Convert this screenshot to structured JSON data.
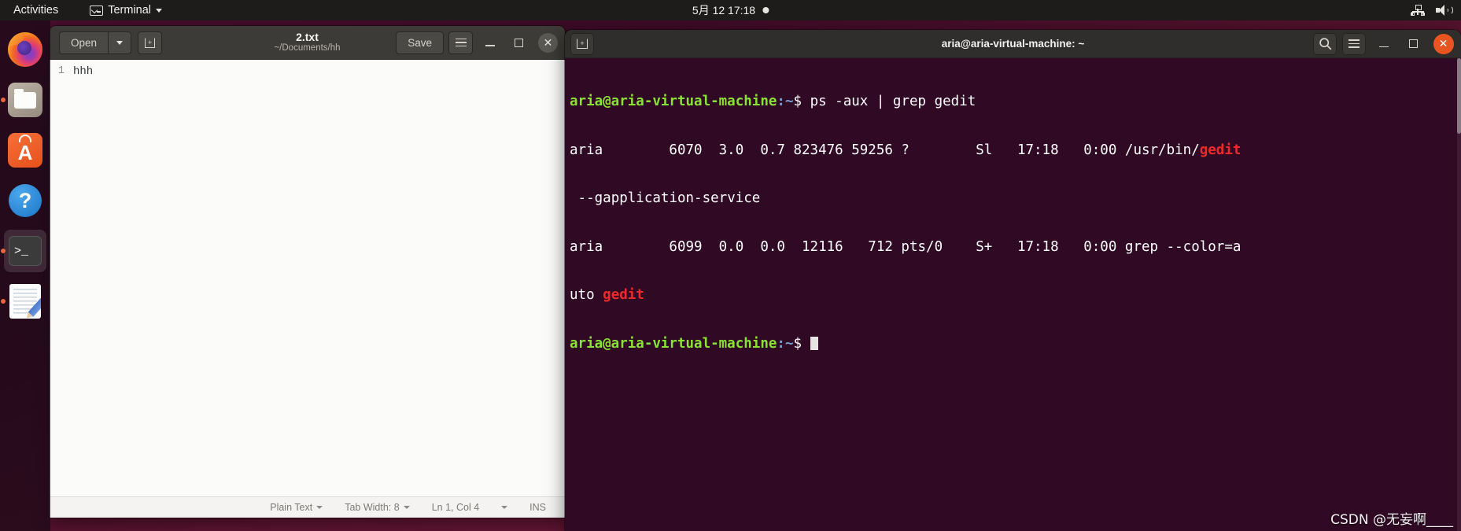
{
  "topbar": {
    "activities": "Activities",
    "app_name": "Terminal",
    "app_icon": "terminal-icon",
    "clock": "5月 12  17:18",
    "notification_dot": "●",
    "network_icon": "network-wired-icon",
    "volume_icon": "volume-icon"
  },
  "dock": {
    "items": [
      {
        "name": "firefox",
        "label": "Firefox Web Browser",
        "running": false,
        "active": false
      },
      {
        "name": "files",
        "label": "Files",
        "running": true,
        "active": false
      },
      {
        "name": "ubuntu-software",
        "label": "Ubuntu Software",
        "running": false,
        "active": false
      },
      {
        "name": "help",
        "label": "Help",
        "running": false,
        "active": false
      },
      {
        "name": "terminal",
        "label": "Terminal",
        "running": true,
        "active": true
      },
      {
        "name": "text-editor",
        "label": "Text Editor",
        "running": true,
        "active": false
      }
    ]
  },
  "gedit": {
    "open_label": "Open",
    "new_tab_icon": "new-document-icon",
    "title": "2.txt",
    "subtitle": "~/Documents/hh",
    "save_label": "Save",
    "menu_icon": "hamburger-menu-icon",
    "minimize_icon": "minimize-icon",
    "maximize_icon": "maximize-icon",
    "close_icon": "close-icon",
    "document": {
      "lines": [
        {
          "number": "1",
          "text": "hhh"
        }
      ]
    },
    "statusbar": {
      "language": "Plain Text",
      "tab_width": "Tab Width: 8",
      "position": "Ln 1, Col 4",
      "insert_mode": "INS"
    }
  },
  "terminal": {
    "new_tab_icon": "new-tab-icon",
    "title": "aria@aria-virtual-machine: ~",
    "search_icon": "search-icon",
    "menu_icon": "hamburger-menu-icon",
    "minimize_icon": "minimize-icon",
    "maximize_icon": "maximize-icon",
    "close_icon": "close-icon",
    "prompt_user": "aria@aria-virtual-machine",
    "prompt_path": ":~",
    "prompt_symbol": "$ ",
    "lines": [
      {
        "type": "command",
        "user": "aria@aria-virtual-machine",
        "path": ":~",
        "symbol": "$ ",
        "command": "ps -aux | grep gedit"
      },
      {
        "type": "output",
        "pre": "aria        6070  3.0  0.7 823476 59256 ?        Sl   17:18   0:00 /usr/bin/",
        "highlight": "gedit",
        "post": ""
      },
      {
        "type": "output",
        "pre": " --gapplication-service",
        "highlight": "",
        "post": ""
      },
      {
        "type": "output",
        "pre": "aria        6099  0.0  0.0  12116   712 pts/0    S+   17:18   0:00 grep --color=a",
        "highlight": "",
        "post": ""
      },
      {
        "type": "output",
        "pre": "uto ",
        "highlight": "gedit",
        "post": ""
      },
      {
        "type": "prompt",
        "user": "aria@aria-virtual-machine",
        "path": ":~",
        "symbol": "$ ",
        "command": ""
      }
    ]
  },
  "watermark": "CSDN @无妄啊____"
}
